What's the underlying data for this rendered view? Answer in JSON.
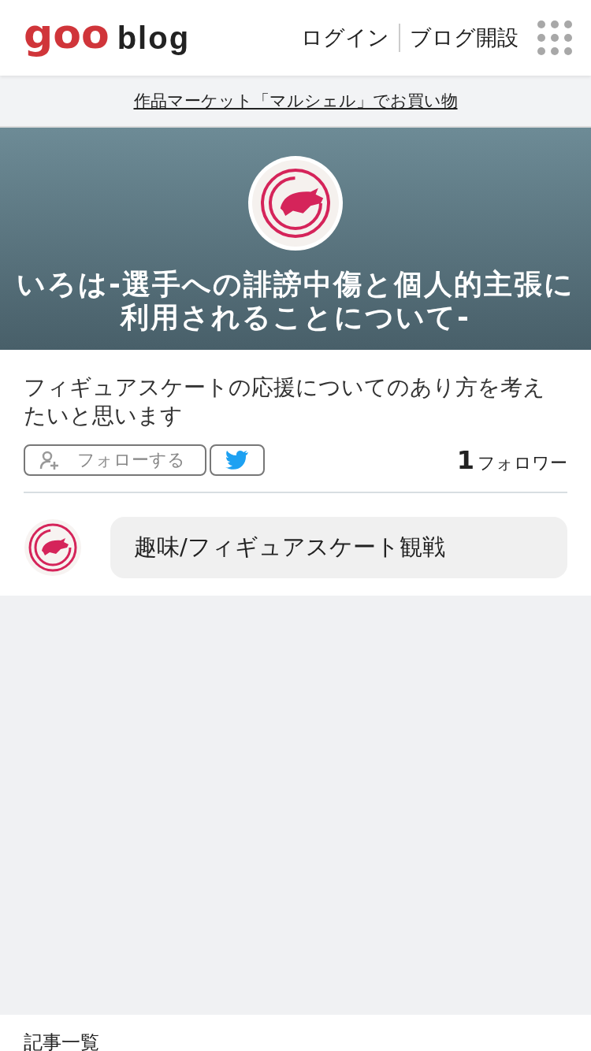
{
  "header": {
    "logo_mark": "goo",
    "logo_text": "blog",
    "nav": [
      {
        "label": "ログイン"
      },
      {
        "label": "ブログ開設"
      }
    ]
  },
  "promo_link": "作品マーケット「マルシェル」でお買い物",
  "hero": {
    "title": "いろは-選手への誹謗中傷と個人的主張に利用されることについて-"
  },
  "profile": {
    "description": "フィギュアスケートの応援についてのあり方を考えたいと思います",
    "follow_button": "フォローする",
    "follower_count": "1",
    "follower_label": "フォロワー"
  },
  "category": {
    "label": "趣味/フィギュアスケート観戦"
  },
  "section_title": "記事一覧"
}
